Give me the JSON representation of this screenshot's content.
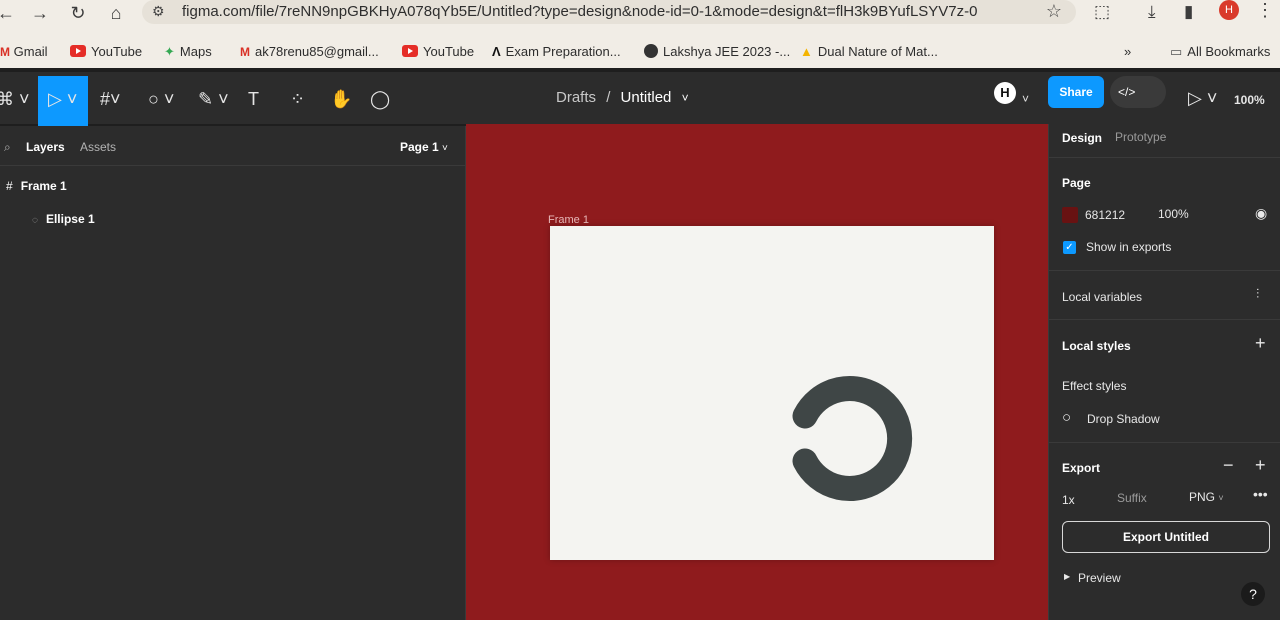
{
  "browser": {
    "url": "figma.com/file/7reNN9npGBKHyA078qYb5E/Untitled?type=design&node-id=0-1&mode=design&t=flH3k9BYufLSYV7z-0",
    "avatar_letter": "H",
    "bookmarks": [
      {
        "label": "Gmail"
      },
      {
        "label": "YouTube"
      },
      {
        "label": "Maps"
      },
      {
        "label": "ak78renu85@gmail..."
      },
      {
        "label": "YouTube"
      },
      {
        "label": "Exam Preparation..."
      },
      {
        "label": "Lakshya JEE 2023 -..."
      },
      {
        "label": "Dual Nature of Mat..."
      }
    ],
    "all_bookmarks": "All Bookmarks",
    "more_bookmarks": "»"
  },
  "toolbar": {
    "file_project": "Drafts",
    "separator": "/",
    "file_name": "Untitled",
    "share_label": "Share",
    "code_label": "</>",
    "zoom": "100%",
    "user_initial": "H"
  },
  "left_panel": {
    "tabs": {
      "layers": "Layers",
      "assets": "Assets"
    },
    "page_selector": "Page 1",
    "layers": [
      {
        "name": "Frame 1"
      },
      {
        "name": "Ellipse 1"
      }
    ]
  },
  "canvas": {
    "frame_label": "Frame 1",
    "background_color": "#8f1b1d",
    "frame_fill": "#f4f4f1",
    "ellipse_color": "#3f4646"
  },
  "right_panel": {
    "tabs": {
      "design": "Design",
      "prototype": "Prototype"
    },
    "page_section": "Page",
    "page_color_hex": "681212",
    "page_color": "#681212",
    "page_opacity": "100%",
    "show_in_exports": "Show in exports",
    "local_variables": "Local variables",
    "local_styles": "Local styles",
    "effect_styles": "Effect styles",
    "drop_shadow": "Drop Shadow",
    "export_section": "Export",
    "export_scale": "1x",
    "export_suffix_placeholder": "Suffix",
    "export_format": "PNG",
    "export_button": "Export Untitled",
    "preview": "Preview",
    "help": "?"
  }
}
